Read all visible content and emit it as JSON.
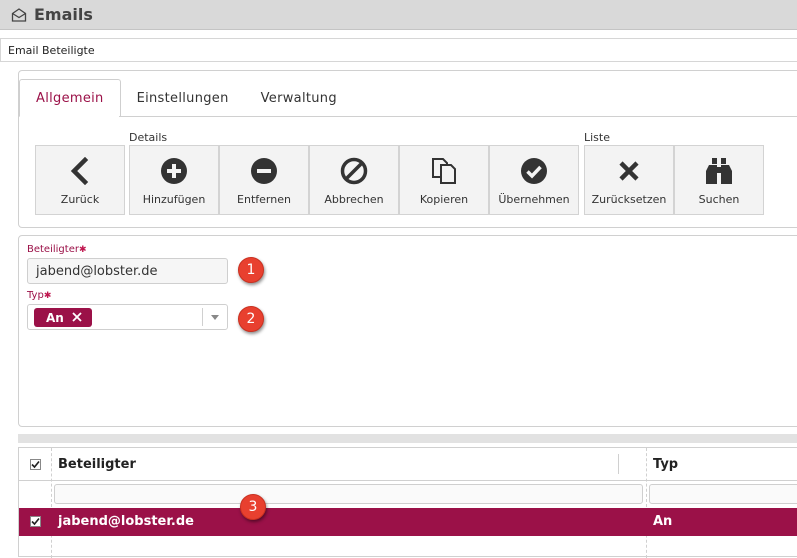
{
  "app": {
    "title": "Emails",
    "icon": "mail-open-icon"
  },
  "panel": {
    "title": "Email Beteiligte"
  },
  "tabs": [
    {
      "label": "Allgemein",
      "active": true
    },
    {
      "label": "Einstellungen",
      "active": false
    },
    {
      "label": "Verwaltung",
      "active": false
    }
  ],
  "toolbar": {
    "group_details": "Details",
    "group_liste": "Liste",
    "buttons": [
      {
        "label": "Zurück",
        "icon": "chevron-left-icon"
      },
      {
        "label": "Hinzufügen",
        "icon": "plus-circle-icon"
      },
      {
        "label": "Entfernen",
        "icon": "minus-circle-icon"
      },
      {
        "label": "Abbrechen",
        "icon": "cancel-circle-icon"
      },
      {
        "label": "Kopieren",
        "icon": "copy-icon"
      },
      {
        "label": "Übernehmen",
        "icon": "check-circle-icon"
      },
      {
        "label": "Zurücksetzen",
        "icon": "x-icon"
      },
      {
        "label": "Suchen",
        "icon": "binoculars-icon"
      }
    ]
  },
  "form": {
    "beteiligter_label": "Beteiligter",
    "beteiligter_value": "jabend@lobster.de",
    "typ_label": "Typ",
    "typ_tag": "An",
    "required_mark": "✱"
  },
  "callouts": [
    "1",
    "2",
    "3"
  ],
  "grid": {
    "columns": [
      "Beteiligter",
      "Typ"
    ],
    "rows": [
      {
        "beteiligter": "jabend@lobster.de",
        "typ": "An",
        "checked": true,
        "selected": true
      }
    ]
  },
  "colors": {
    "accent": "#9b1148",
    "callout": "#e8402f"
  }
}
